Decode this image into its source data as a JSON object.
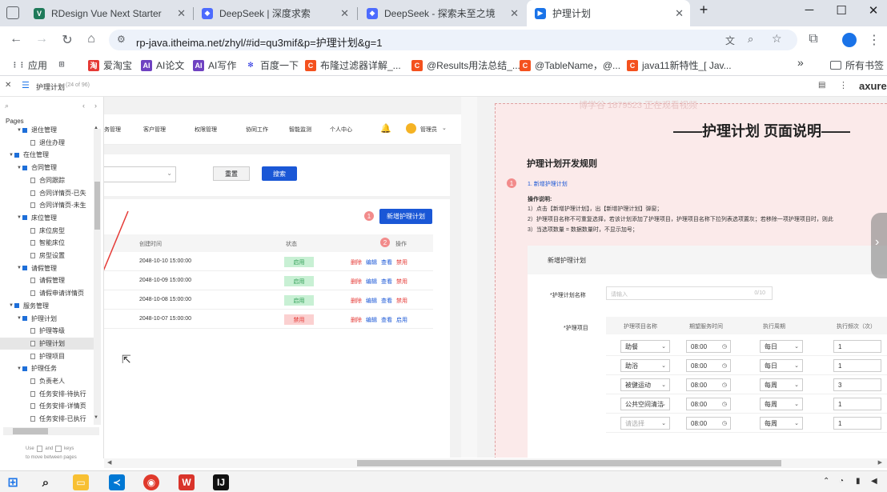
{
  "browser": {
    "tabs": [
      {
        "title": "RDesign Vue Next Starter",
        "icon": "vue-icon",
        "color": "#1f7a5a"
      },
      {
        "title": "DeepSeek | 深度求索",
        "icon": "deepseek-icon",
        "color": "#4d6bfe"
      },
      {
        "title": "DeepSeek - 探索未至之境",
        "icon": "deepseek-icon",
        "color": "#4d6bfe"
      },
      {
        "title": "护理计划",
        "icon": "axure-icon",
        "color": "#1a73e8"
      }
    ],
    "new_tab": "+",
    "url": "rp-java.itheima.net/zhyl/#id=qu3mif&p=护理计划&g=1",
    "bookmarks": [
      "应用",
      "爱淘宝",
      "AI论文",
      "AI写作",
      "百度一下",
      "布隆过滤器详解_...",
      "@Results用法总结_...",
      "@TableName，@...",
      "java11新特性_[ Jav..."
    ],
    "bookmark_more": "»",
    "all_bookmarks": "所有书签"
  },
  "axure": {
    "page_title": "护理计划",
    "page_count": "(24 of 96)",
    "brand": "axure"
  },
  "pages_panel": {
    "heading": "Pages",
    "items": [
      {
        "label": "退住管理",
        "type": "folder",
        "level": 1
      },
      {
        "label": "退住办理",
        "type": "page",
        "level": 2
      },
      {
        "label": "在住管理",
        "type": "folder",
        "level": 0
      },
      {
        "label": "合同管理",
        "type": "folder",
        "level": 1
      },
      {
        "label": "合同跟踪",
        "type": "page",
        "level": 2
      },
      {
        "label": "合同详情页-已失",
        "type": "page",
        "level": 2
      },
      {
        "label": "合同详情页-未生",
        "type": "page",
        "level": 2
      },
      {
        "label": "床位管理",
        "type": "folder",
        "level": 1
      },
      {
        "label": "床位房型",
        "type": "page",
        "level": 2
      },
      {
        "label": "智能床位",
        "type": "page",
        "level": 2
      },
      {
        "label": "房型设置",
        "type": "page",
        "level": 2
      },
      {
        "label": "请假管理",
        "type": "folder",
        "level": 1
      },
      {
        "label": "请假管理",
        "type": "page",
        "level": 2
      },
      {
        "label": "请假申请详情页",
        "type": "page",
        "level": 2
      },
      {
        "label": "服务管理",
        "type": "folder",
        "level": 0
      },
      {
        "label": "护理计划",
        "type": "folder",
        "level": 1
      },
      {
        "label": "护理等级",
        "type": "page",
        "level": 2
      },
      {
        "label": "护理计划",
        "type": "page",
        "level": 2,
        "selected": true
      },
      {
        "label": "护理项目",
        "type": "page",
        "level": 2
      },
      {
        "label": "护理任务",
        "type": "folder",
        "level": 1
      },
      {
        "label": "负责老人",
        "type": "page",
        "level": 2
      },
      {
        "label": "任务安排-待执行",
        "type": "page",
        "level": 2
      },
      {
        "label": "任务安排-详情页",
        "type": "page",
        "level": 2
      },
      {
        "label": "任务安排-已执行",
        "type": "page",
        "level": 2
      }
    ],
    "hint_use": "Use",
    "hint_and": "and",
    "hint_keys": "keys",
    "hint_move": "to move between pages"
  },
  "wireframe": {
    "nav": [
      "务管理",
      "客户管理",
      "权限管理",
      "协同工作",
      "智能监测",
      "个人中心"
    ],
    "user": "管理员",
    "reset": "重置",
    "search": "搜索",
    "new_plan": "新增护理计划",
    "col_created": "创建时间",
    "col_status": "状态",
    "col_ops": "操作",
    "marker1": "1",
    "marker2": "2",
    "rows": [
      {
        "time": "2048-10-10 15:00:00",
        "status": "启用",
        "ops": [
          "删除",
          "编辑",
          "查看",
          "禁用"
        ]
      },
      {
        "time": "2048-10-09 15:00:00",
        "status": "启用",
        "ops": [
          "删除",
          "编辑",
          "查看",
          "禁用"
        ]
      },
      {
        "time": "2048-10-08 15:00:00",
        "status": "启用",
        "ops": [
          "删除",
          "编辑",
          "查看",
          "禁用"
        ]
      },
      {
        "time": "2048-10-07 15:00:00",
        "status": "禁用",
        "ops": [
          "删除",
          "编辑",
          "查看",
          "启用"
        ]
      }
    ]
  },
  "spec": {
    "watermark": "博学谷 1879523 正在观看视频",
    "title": "——护理计划 页面说明——",
    "rules_heading": "护理计划开发规则",
    "marker": "1",
    "item1": "1. 新增护理计划",
    "op_heading": "操作说明:",
    "lines": [
      "1）点击【新增护理计划】，出【新增护理计划】弹窗；",
      "2）护理项目名称不可重复选择，若该计划添加了护理项目，护理项目名称下拉列表选项置灰；若移除一项护理项目时，则此",
      "3）当选项数量 = 数据数量时，不显示加号；"
    ],
    "form_title": "新增护理计划",
    "name_label": "*护理计划名称",
    "name_placeholder": "请输入",
    "name_count": "0/10",
    "items_label": "*护理项目",
    "headers": [
      "护理项目名称",
      "期望服务时间",
      "执行周期",
      "执行频次（次）"
    ],
    "rows": [
      {
        "name": "助餐",
        "time": "08:00",
        "cycle": "每日",
        "freq": "1"
      },
      {
        "name": "助浴",
        "time": "08:00",
        "cycle": "每日",
        "freq": "1"
      },
      {
        "name": "被健运动",
        "time": "08:00",
        "cycle": "每周",
        "freq": "3"
      },
      {
        "name": "公共空间清洁",
        "time": "08:00",
        "cycle": "每周",
        "freq": "1"
      },
      {
        "name": "请选择",
        "time": "08:00",
        "cycle": "每周",
        "freq": "1"
      }
    ]
  }
}
